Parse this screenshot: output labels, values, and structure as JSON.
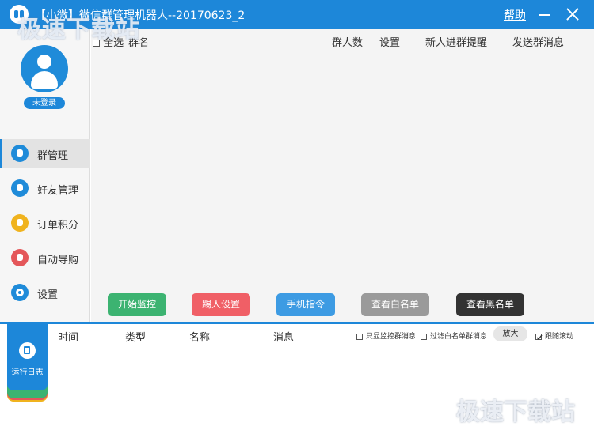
{
  "titlebar": {
    "title": "【小微】微信群管理机器人--20170623_2",
    "help": "帮助",
    "logo_icon": "robot-logo-icon",
    "bg_color": "#1d87d9"
  },
  "watermark": {
    "top": "极速下载站",
    "bottom": "极速下载站"
  },
  "user": {
    "status": "未登录",
    "avatar_icon": "user-avatar-icon"
  },
  "sidebar": {
    "items": [
      {
        "label": "群管理",
        "icon": "group-icon",
        "color": "#1f8bd9",
        "active": true
      },
      {
        "label": "好友管理",
        "icon": "friend-icon",
        "color": "#1f8bd9",
        "active": false
      },
      {
        "label": "订单积分",
        "icon": "order-icon",
        "color": "#f0b31e",
        "active": false
      },
      {
        "label": "自动导购",
        "icon": "cart-icon",
        "color": "#e4575a",
        "active": false
      },
      {
        "label": "设置",
        "icon": "gear-icon",
        "color": "#1f8bd9",
        "active": false
      }
    ]
  },
  "group_table": {
    "select_all": "全选",
    "columns": [
      "群名",
      "群人数",
      "设置",
      "新人进群提醒",
      "发送群消息"
    ]
  },
  "actions": [
    {
      "label": "开始监控",
      "color": "#3cb371"
    },
    {
      "label": "踢人设置",
      "color": "#f05f66"
    },
    {
      "label": "手机指令",
      "color": "#3d9be3"
    },
    {
      "label": "查看白名单",
      "color": "#9a9a9a"
    },
    {
      "label": "查看黑名单",
      "color": "#333333"
    }
  ],
  "log": {
    "tab_label": "运行日志",
    "tab_icon": "document-icon",
    "columns": [
      "时间",
      "类型",
      "名称",
      "消息"
    ],
    "options": {
      "only_monitor": "只显监控群消息",
      "filter_whitelist": "过滤白名单群消息",
      "zoom": "放大",
      "follow_scroll": "跟随滚动",
      "follow_scroll_checked": true
    }
  }
}
